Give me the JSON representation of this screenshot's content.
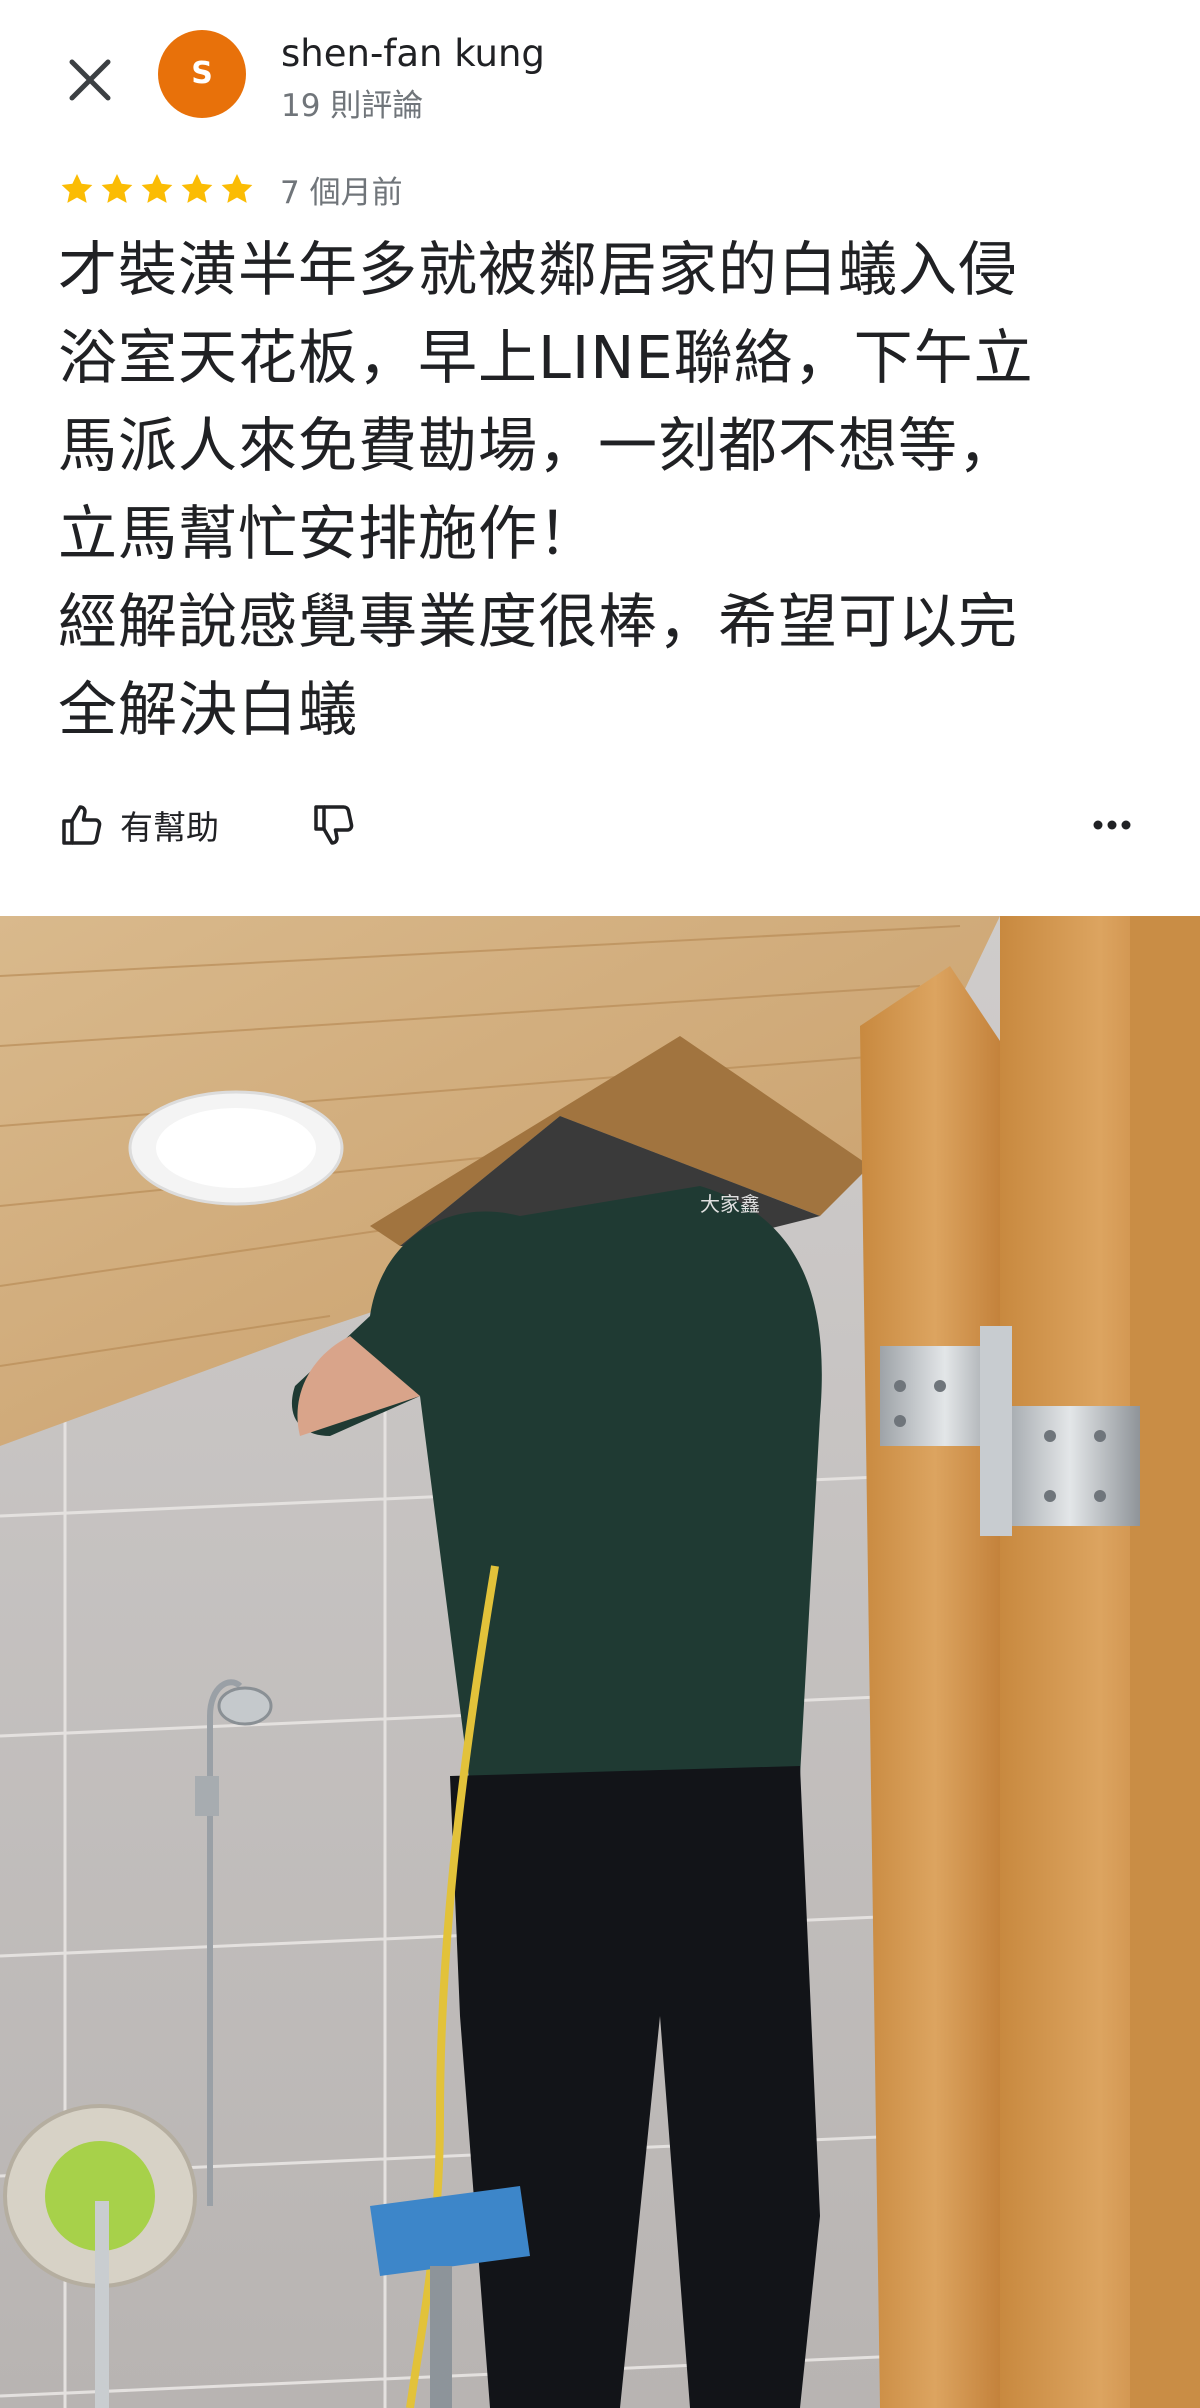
{
  "review": {
    "author": {
      "name": "shen-fan kung",
      "initial": "S",
      "review_count": "19 則評論",
      "avatar_color": "#e8710a"
    },
    "rating": 5,
    "star_color": "#fbbc04",
    "time_ago": "7 個月前",
    "text": "才裝潢半年多就被鄰居家的白蟻入侵\n浴室天花板，早上LINE聯絡，下午立\n馬派人來免費勘場，一刻都不想等，\n立馬幫忙安排施作！\n經解說感覺專業度很棒，希望可以完\n全解決白蟻",
    "actions": {
      "helpful_label": "有幫助"
    },
    "photo": {
      "shirt_logo": "大家鑫"
    }
  },
  "icons": {
    "close": "close-icon",
    "like": "thumb-up-icon",
    "dislike": "thumb-down-icon",
    "more": "more-horiz-icon"
  }
}
